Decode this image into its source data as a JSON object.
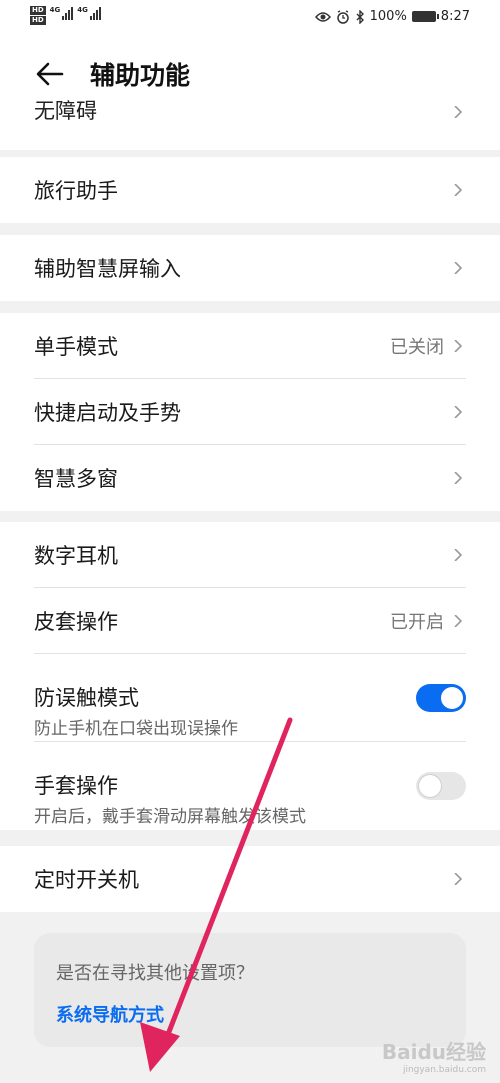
{
  "status_bar": {
    "hd1": "HD",
    "hd2": "HD",
    "net1": "4G",
    "net2": "4G",
    "battery_text": "100%",
    "time": "8:27",
    "icons": [
      "eye-icon",
      "alarm-icon",
      "bluetooth-icon",
      "battery-icon"
    ]
  },
  "header": {
    "title": "辅助功能",
    "back_icon": "back-arrow-icon"
  },
  "partial_item": {
    "label": "无障碍"
  },
  "groups": [
    {
      "items": [
        {
          "label": "旅行助手"
        }
      ]
    },
    {
      "items": [
        {
          "label": "辅助智慧屏输入"
        }
      ]
    },
    {
      "items": [
        {
          "label": "单手模式",
          "value": "已关闭"
        },
        {
          "label": "快捷启动及手势"
        },
        {
          "label": "智慧多窗"
        }
      ]
    },
    {
      "items": [
        {
          "label": "数字耳机"
        },
        {
          "label": "皮套操作",
          "value": "已开启"
        },
        {
          "label": "防误触模式",
          "sub": "防止手机在口袋出现误操作",
          "toggle": true
        },
        {
          "label": "手套操作",
          "sub": "开启后，戴手套滑动屏幕触发该模式",
          "toggle": false
        }
      ]
    },
    {
      "items": [
        {
          "label": "定时开关机"
        }
      ]
    }
  ],
  "suggestion": {
    "question": "是否在寻找其他设置项？",
    "link": "系统导航方式"
  },
  "annotation": {
    "color": "#e0245e"
  },
  "watermark": {
    "brand": "Baidu经验",
    "url": "jingyan.baidu.com"
  },
  "colors": {
    "accent": "#0a6cf0",
    "background": "#f1f1f1"
  }
}
